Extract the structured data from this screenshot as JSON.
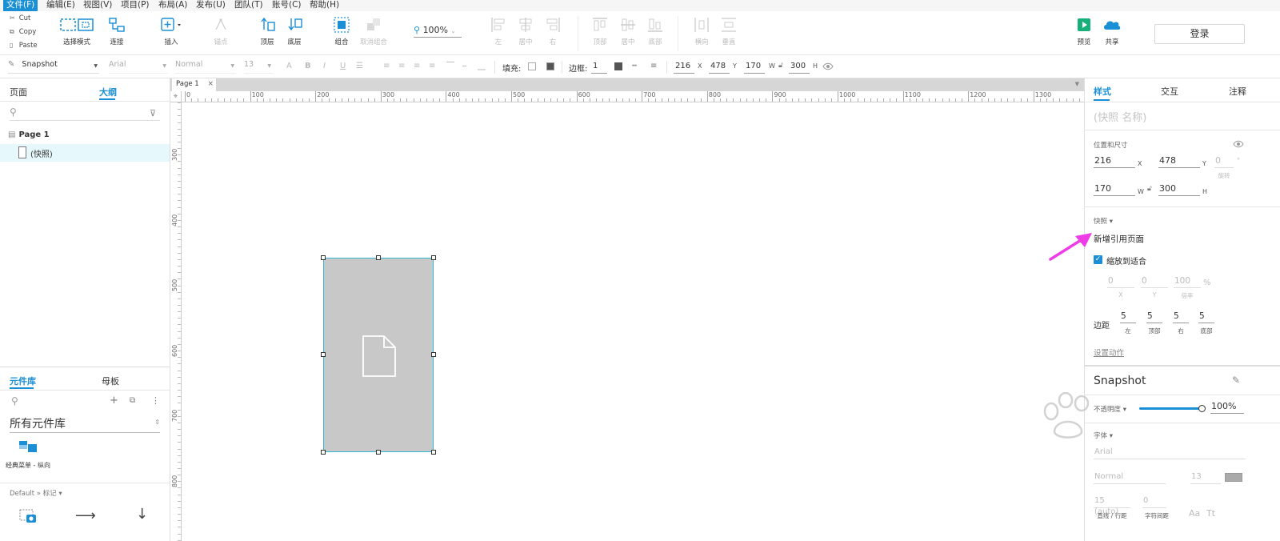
{
  "menu": [
    {
      "label": "文件(F)",
      "active": true
    },
    {
      "label": "编辑(E)"
    },
    {
      "label": "视图(V)"
    },
    {
      "label": "项目(P)"
    },
    {
      "label": "布局(A)"
    },
    {
      "label": "发布(U)"
    },
    {
      "label": "团队(T)"
    },
    {
      "label": "账号(C)"
    },
    {
      "label": "帮助(H)"
    }
  ],
  "clipboard": {
    "cut": "Cut",
    "copy": "Copy",
    "paste": "Paste"
  },
  "toolbar": {
    "select_mode": "选择模式",
    "connect": "连接",
    "insert": "插入",
    "points": "锚点",
    "top_layer": "顶层",
    "bottom_layer": "底层",
    "group": "组合",
    "ungroup": "取消组合",
    "zoom": "100%",
    "align_left": "左",
    "align_center": "居中",
    "align_right": "右",
    "align_top": "顶部",
    "align_middle": "居中",
    "align_bottom": "底部",
    "dist_h": "横向",
    "dist_v": "垂直",
    "preview": "预览",
    "share": "共享",
    "login": "登录"
  },
  "format": {
    "style_name": "Snapshot",
    "font": "Arial",
    "weight": "Normal",
    "size": "13",
    "fill_label": "填充:",
    "border_label": "边框:",
    "border_value": "1",
    "x": "216",
    "x_unit": "X",
    "y": "478",
    "y_unit": "Y",
    "w": "170",
    "w_unit": "W",
    "h": "300",
    "h_unit": "H"
  },
  "left": {
    "tab_pages": "页面",
    "tab_outline": "大纲",
    "outline": [
      {
        "label": "Page 1"
      },
      {
        "label": "(快照)"
      }
    ],
    "lib_tab": "元件库",
    "master_tab": "母板",
    "lib_select": "所有元件库",
    "lib_item": "经典菜单 - 纵向",
    "default_label": "Default » 标记 ▾"
  },
  "canvas": {
    "page_tab": "Page 1",
    "hruler": [
      "0",
      "100",
      "200",
      "300",
      "400",
      "500",
      "600",
      "700",
      "800",
      "900",
      "1000",
      "1100",
      "1200",
      "1300"
    ],
    "vruler": [
      "300",
      "400",
      "500",
      "600",
      "700",
      "800"
    ]
  },
  "right": {
    "tab_style": "样式",
    "tab_interact": "交互",
    "tab_notes": "注释",
    "name_placeholder": "(快照 名称)",
    "pos_size": "位置和尺寸",
    "x": "216",
    "x_unit": "X",
    "y": "478",
    "y_unit": "Y",
    "rot": "0",
    "rot_unit": "°",
    "rot_label": "旋转",
    "w": "170",
    "w_unit": "W",
    "h": "300",
    "h_unit": "H",
    "snapshot_label": "快照 ▾",
    "ref_page": "新增引用页面",
    "fit_scale": "缩放到适合",
    "off_x": "0",
    "off_x_lbl": "X",
    "off_y": "0",
    "off_y_lbl": "Y",
    "scale": "100",
    "scale_unit": "%",
    "scale_lbl": "倍率",
    "margin_label": "边距",
    "m_left": "5",
    "m_left_lbl": "左",
    "m_top": "5",
    "m_top_lbl": "顶部",
    "m_right": "5",
    "m_right_lbl": "右",
    "m_bottom": "5",
    "m_bottom_lbl": "底部",
    "set_action": "设置动作",
    "style_title": "Snapshot",
    "opacity_label": "不透明度 ▾",
    "opacity_value": "100%",
    "font_section": "字体 ▾",
    "font_name": "Arial",
    "font_weight": "Normal",
    "font_size": "13",
    "line_height": "15 (auto)",
    "char_spacing": "0",
    "lh_label": "直线 / 行距",
    "cs_label": "字符间距"
  },
  "colors": {
    "accent": "#1a8fd6",
    "selection": "#35b6d3",
    "shape_fill": "#c8c8c8",
    "arrow": "#ee3ce7"
  }
}
